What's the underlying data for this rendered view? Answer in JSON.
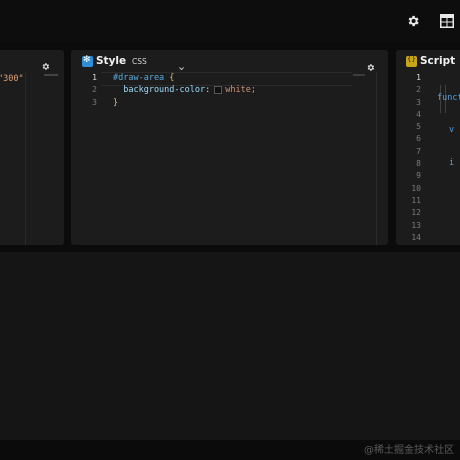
{
  "topbar": {
    "settings_icon": "gear-icon",
    "layout_icon": "layout-grid-icon"
  },
  "html_panel": {
    "code_fragment": "\"300\"",
    "settings_icon": "gear-icon"
  },
  "style_panel": {
    "title": "Style",
    "language": "CSS",
    "line_numbers": [
      "1",
      "2",
      "3"
    ],
    "active_line": 1,
    "code": {
      "line1_selector": "#draw-area",
      "line1_brace": " {",
      "line2_property": "  background-color:",
      "line2_value": "white;",
      "line3": "}"
    },
    "swatch_color": "#000000"
  },
  "script_panel": {
    "title": "Script",
    "line_numbers": [
      "1",
      "2",
      "3",
      "4",
      "5",
      "6",
      "7",
      "8",
      "9",
      "10",
      "11",
      "12",
      "13",
      "14"
    ],
    "active_line": 1,
    "code_line1": "funct",
    "code_line2": "v",
    "code_line3": "i"
  },
  "watermark": "@稀土掘金技术社区",
  "colors": {
    "background": "#151515",
    "panel": "#1c1c1c",
    "style_badge": "#2e8fd8",
    "script_badge": "#c9a518"
  }
}
